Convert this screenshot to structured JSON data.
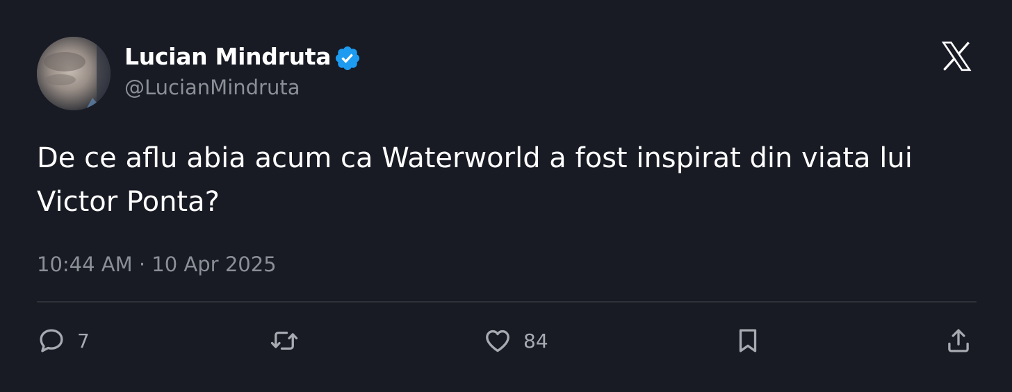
{
  "tweet": {
    "author": {
      "display_name": "Lucian Mindruta",
      "handle": "@LucianMindruta",
      "verified": true,
      "verified_color": "#1d9bf0"
    },
    "text_lines": [
      "De ce aflu abia acum ca Waterworld a fost inspirat din viata lui",
      "Victor Ponta?"
    ],
    "timestamp": "10:44 AM · 10 Apr 2025",
    "brand_icon": "x-logo-icon"
  },
  "actions": {
    "reply": {
      "icon": "reply-icon",
      "count": "7"
    },
    "retweet": {
      "icon": "retweet-icon",
      "count": ""
    },
    "like": {
      "icon": "heart-icon",
      "count": "84"
    },
    "bookmark": {
      "icon": "bookmark-icon",
      "count": ""
    },
    "share": {
      "icon": "share-icon",
      "count": ""
    }
  },
  "colors": {
    "background": "#181a24",
    "primary_text": "#ffffff",
    "secondary_text": "#8b8f96",
    "divider": "#2f3236"
  }
}
